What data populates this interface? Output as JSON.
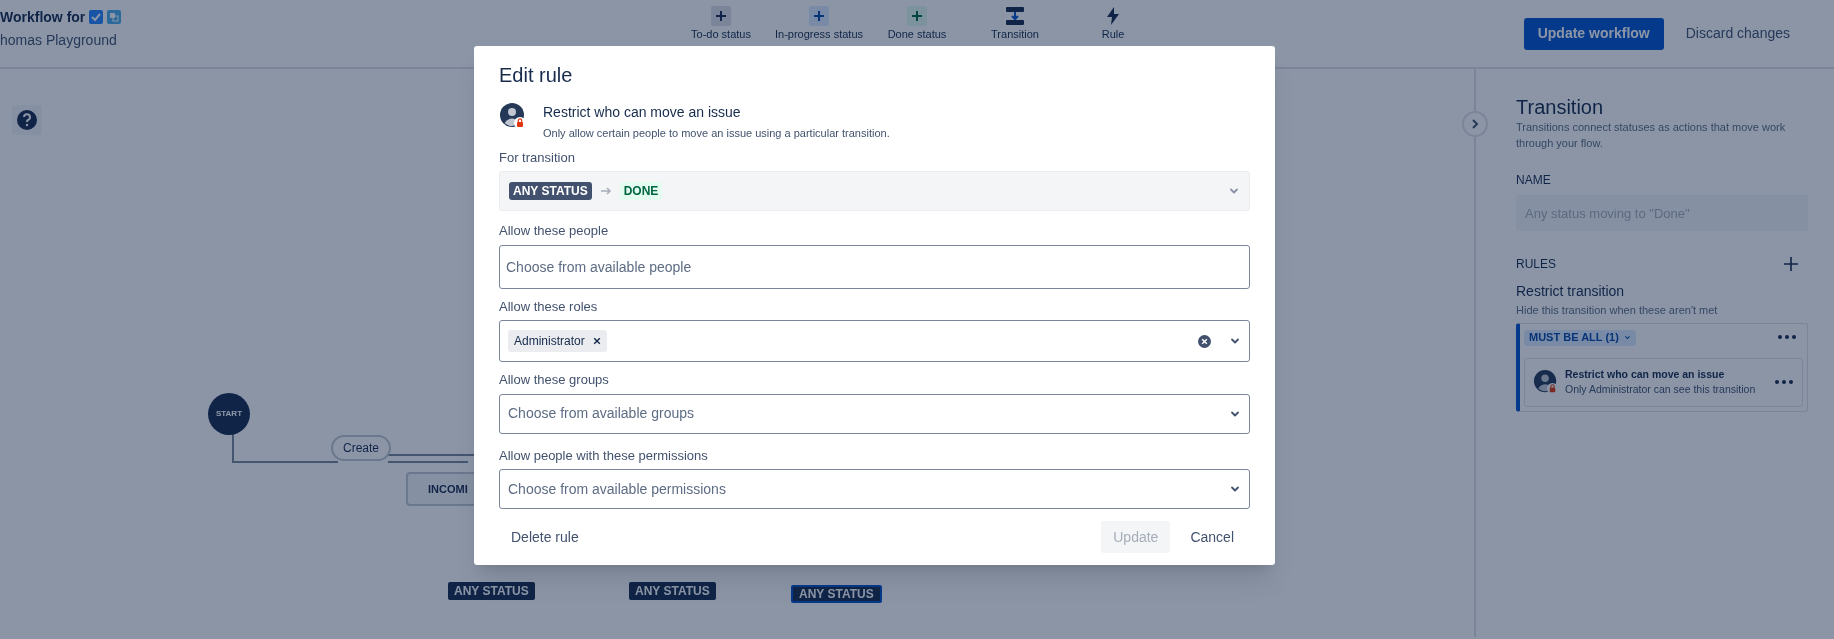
{
  "header": {
    "title": "Workflow for",
    "subtitle": "homas Playground",
    "toolbar": [
      {
        "label": "To-do status",
        "kind": "todo"
      },
      {
        "label": "In-progress status",
        "kind": "inprogress"
      },
      {
        "label": "Done status",
        "kind": "done"
      },
      {
        "label": "Transition",
        "kind": "transition"
      },
      {
        "label": "Rule",
        "kind": "rule"
      }
    ],
    "primary_button": "Update workflow",
    "secondary_button": "Discard changes"
  },
  "canvas": {
    "start": "START",
    "transition": "Create",
    "status": "INCOMI",
    "any_status": [
      {
        "label": "ANY STATUS",
        "selected": false
      },
      {
        "label": "ANY STATUS",
        "selected": false
      },
      {
        "label": "ANY STATUS",
        "selected": true
      }
    ]
  },
  "panel": {
    "title": "Transition",
    "description": "Transitions connect statuses as actions that move work through your flow.",
    "name_label": "NAME",
    "name_value": "Any status moving to \"Done\"",
    "rules_label": "RULES",
    "section_title": "Restrict transition",
    "section_description": "Hide this transition when these aren't met",
    "group_chip": "MUST BE ALL (1)",
    "rule": {
      "title": "Restrict who can move an issue",
      "description": "Only Administrator can see this transition"
    }
  },
  "modal": {
    "title": "Edit rule",
    "rule": {
      "title": "Restrict who can move an issue",
      "description": "Only allow certain people to move an issue using a particular transition."
    },
    "fields": [
      {
        "kind": "transition",
        "label": "For transition",
        "from": "ANY STATUS",
        "to": "DONE"
      },
      {
        "kind": "text",
        "label": "Allow these people",
        "placeholder": "Choose from available people"
      },
      {
        "kind": "multiselect",
        "label": "Allow these roles",
        "tags": [
          "Administrator"
        ]
      },
      {
        "kind": "select",
        "label": "Allow these groups",
        "placeholder": "Choose from available groups"
      },
      {
        "kind": "select",
        "label": "Allow people with these permissions",
        "placeholder": "Choose from available permissions"
      }
    ],
    "delete_button": "Delete rule",
    "update_button": {
      "label": "Update",
      "disabled": true
    },
    "cancel_button": "Cancel"
  }
}
